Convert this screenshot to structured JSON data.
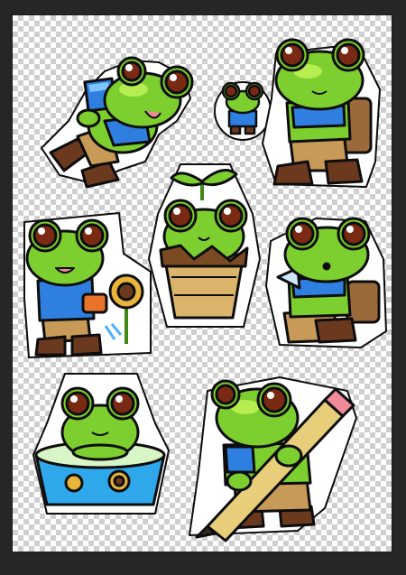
{
  "document": {
    "canvas_background": "transparent-checkerboard",
    "frame_color": "#262626"
  },
  "palette": {
    "frog_green": "#7ccf2e",
    "frog_light": "#b6ee52",
    "frog_dark": "#3f8a17",
    "outline": "#0d0d0d",
    "eye_brown": "#7a2a12",
    "eye_light": "#c35a22",
    "shirt_blue": "#2f7fe0",
    "pants_tan": "#c79a57",
    "boot_brown": "#6b3a1e",
    "pot_tan": "#d9b46a",
    "bowl_blue": "#2ea8ea",
    "pencil_yellow": "#e8cd7a",
    "eraser_pink": "#f08a9a"
  },
  "stickers": [
    {
      "name": "frog-running-with-cup",
      "pose": "running"
    },
    {
      "name": "tiny-frog",
      "pose": "standing"
    },
    {
      "name": "frog-with-backpack",
      "pose": "walking"
    },
    {
      "name": "frog-in-flower-pot",
      "pose": "potted-sprout"
    },
    {
      "name": "frog-watering-sunflower",
      "pose": "gardening"
    },
    {
      "name": "frog-sitting-thinking",
      "pose": "sitting"
    },
    {
      "name": "frog-in-bath-bowl",
      "pose": "bathing"
    },
    {
      "name": "frog-holding-pencil",
      "pose": "holding-pencil"
    }
  ]
}
